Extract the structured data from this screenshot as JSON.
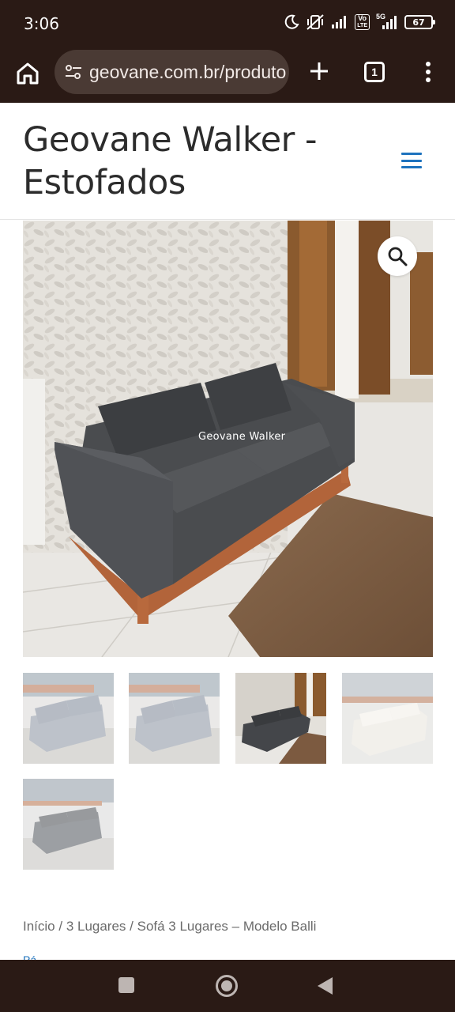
{
  "status_bar": {
    "time": "3:06",
    "network_label_top": "Vo",
    "network_label_bottom": "LTE",
    "signal_label": "5G",
    "battery": "67"
  },
  "browser": {
    "url": "geovane.com.br/produto",
    "tab_count": "1"
  },
  "site": {
    "title": "Geovane Walker - Estofados",
    "accent_color": "#1e73be"
  },
  "product": {
    "watermark": "Geovane Walker"
  },
  "breadcrumb": {
    "home": "Início",
    "separator": " / ",
    "category": "3 Lugares",
    "current": "Sofá 3 Lugares – Modelo Balli"
  },
  "cut_off_link": "Pá..."
}
